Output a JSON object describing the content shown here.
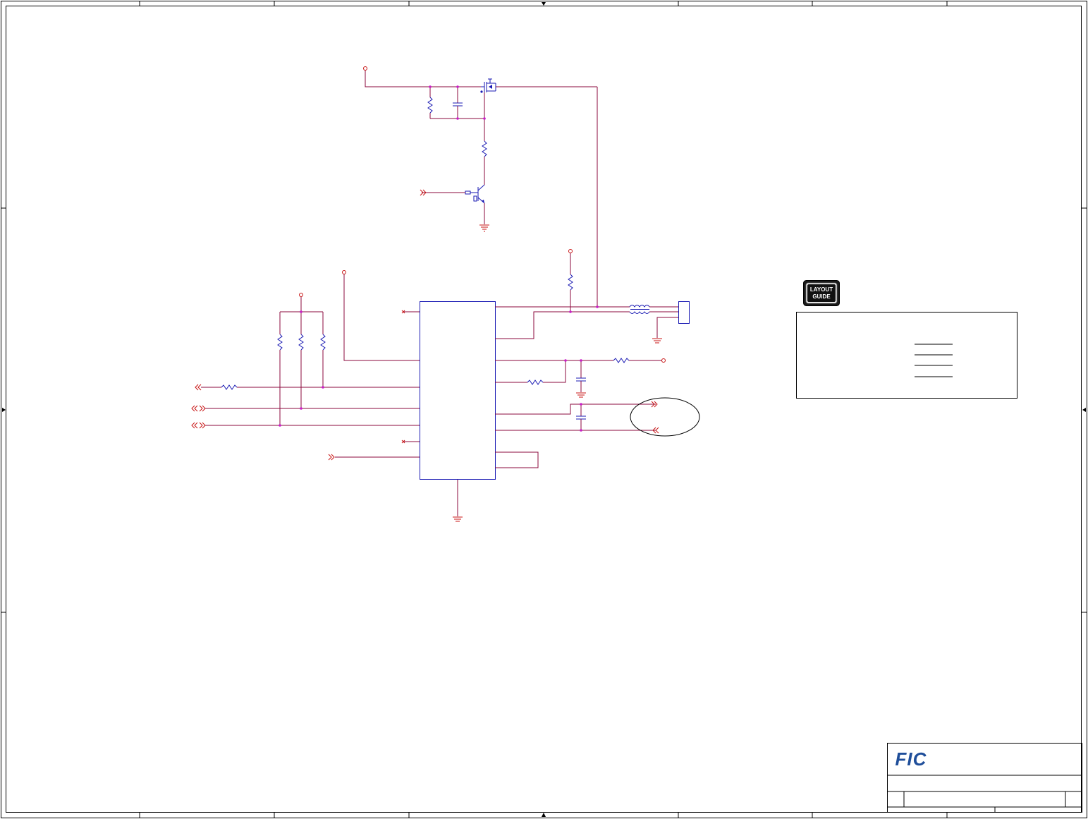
{
  "layout_guide": {
    "badge_line1": "LAYOUT",
    "badge_line2": "GUIDE"
  },
  "title_block": {
    "company_logo": "FIC",
    "logo_color": "#1f4e9a"
  },
  "colors": {
    "wire": "#8b0a3c",
    "component": "#1a1ab3",
    "power_port": "#c81414",
    "junction": "#c81ec8"
  }
}
